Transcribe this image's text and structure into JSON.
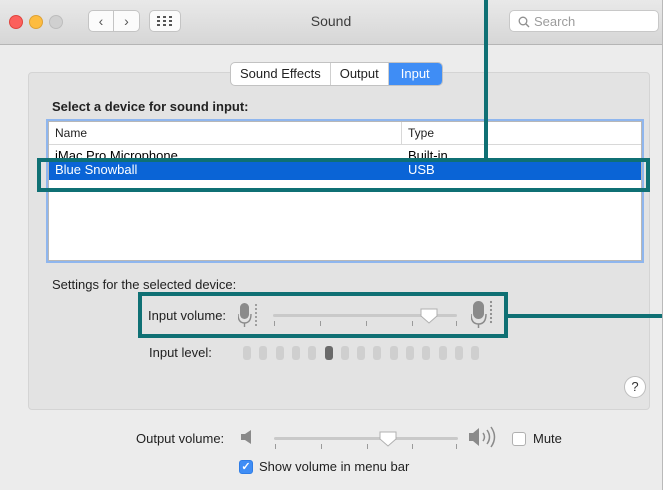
{
  "window": {
    "title": "Sound"
  },
  "toolbar": {
    "back": "‹",
    "forward": "›",
    "grid": "⋮⋮⋮",
    "search_placeholder": "Search"
  },
  "tabs": [
    {
      "label": "Sound Effects",
      "active": false
    },
    {
      "label": "Output",
      "active": false
    },
    {
      "label": "Input",
      "active": true
    }
  ],
  "device_section": {
    "heading": "Select a device for sound input:",
    "columns": [
      "Name",
      "Type"
    ],
    "rows": [
      {
        "name": "iMac Pro Microphone",
        "type": "Built-in",
        "selected": false
      },
      {
        "name": "Blue Snowball",
        "type": "USB",
        "selected": true
      }
    ]
  },
  "settings": {
    "heading": "Settings for the selected device:",
    "input_volume_label": "Input volume:",
    "input_volume_value": 0.85,
    "input_level_label": "Input level:",
    "input_level_segments": 15,
    "input_level_active_index": 5,
    "help": "?"
  },
  "output": {
    "output_volume_label": "Output volume:",
    "output_volume_value": 0.62,
    "mute_label": "Mute",
    "mute_checked": false,
    "show_volume_label": "Show volume in menu bar",
    "show_volume_checked": true
  },
  "colors": {
    "accent": "#3f8df5",
    "selection": "#0a64d6",
    "highlight": "#0f7074"
  }
}
